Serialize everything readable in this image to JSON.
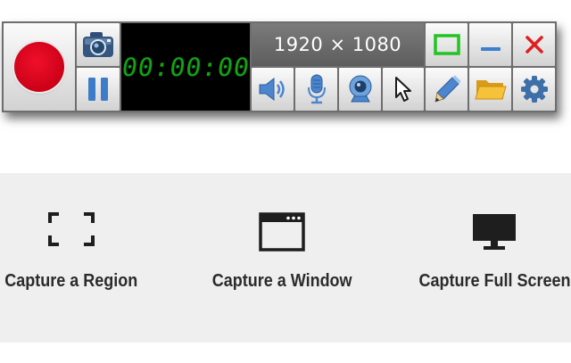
{
  "recorder": {
    "timer": "00:00:00",
    "resolution": "1920 × 1080",
    "buttons": {
      "record": "record-icon",
      "screenshot": "camera-icon",
      "pause": "pause-icon",
      "audio": "speaker-icon",
      "microphone": "microphone-icon",
      "webcam": "webcam-icon",
      "cursor": "cursor-icon",
      "draw": "pencil-icon",
      "folder": "folder-icon",
      "settings": "gear-icon",
      "frame": "frame-icon",
      "minimize": "minimize-icon",
      "close": "close-icon"
    },
    "colors": {
      "record": "#e0061f",
      "timer_text": "#13a313",
      "frame": "#22c322",
      "close": "#e01e1e",
      "minimize": "#3b7fd1"
    }
  },
  "capture_modes": [
    {
      "label": "Capture a Region",
      "icon": "region-icon"
    },
    {
      "label": "Capture a Window",
      "icon": "window-icon"
    },
    {
      "label": "Capture Full Screen",
      "icon": "monitor-icon"
    }
  ]
}
